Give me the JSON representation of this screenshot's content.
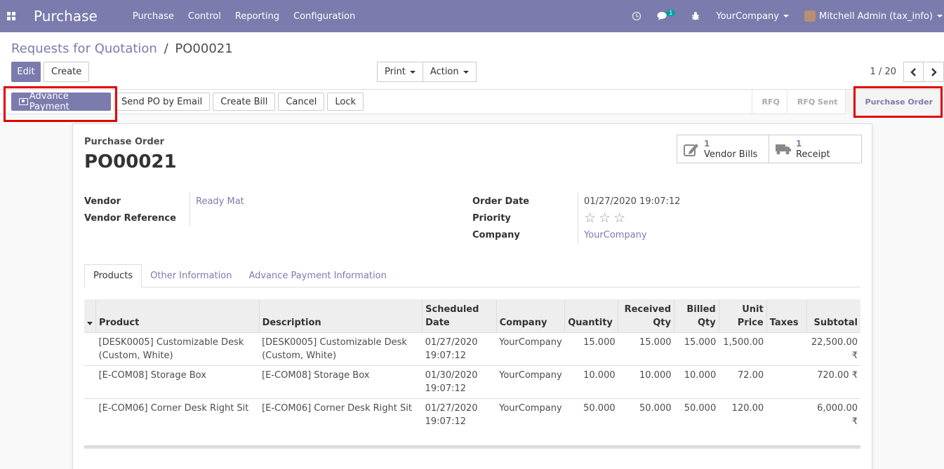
{
  "navbar": {
    "app_name": "Purchase",
    "menu": [
      "Purchase",
      "Control",
      "Reporting",
      "Configuration"
    ],
    "message_count": "1",
    "company": "YourCompany",
    "user": "Mitchell Admin (tax_info)",
    "bg_color": "#7c7bad"
  },
  "breadcrumb": {
    "parent": "Requests for Quotation",
    "separator": "/",
    "current": "PO00021"
  },
  "control": {
    "edit": "Edit",
    "create": "Create",
    "print": "Print",
    "action": "Action",
    "pager": "1 / 20"
  },
  "actions": {
    "advance_payment": "Advance Payment",
    "send_po": "Send PO by Email",
    "create_bill": "Create Bill",
    "cancel": "Cancel",
    "lock": "Lock"
  },
  "stages": [
    "RFQ",
    "RFQ Sent",
    "Purchase Order"
  ],
  "form": {
    "doc_label": "Purchase Order",
    "doc_name": "PO00021",
    "smart_buttons": [
      {
        "count": "1",
        "label": "Vendor Bills",
        "icon": "pencil-square-icon"
      },
      {
        "count": "1",
        "label": "Receipt",
        "icon": "truck-icon"
      }
    ],
    "left_fields": [
      {
        "label": "Vendor",
        "value": "Ready Mat"
      },
      {
        "label": "Vendor Reference",
        "value": ""
      }
    ],
    "right_fields": {
      "order_date_label": "Order Date",
      "order_date": "01/27/2020 19:07:12",
      "priority_label": "Priority",
      "company_label": "Company",
      "company": "YourCompany"
    }
  },
  "tabs": [
    "Products",
    "Other Information",
    "Advance Payment Information"
  ],
  "table": {
    "headers": [
      "Product",
      "Description",
      "Scheduled Date",
      "Company",
      "Quantity",
      "Received Qty",
      "Billed Qty",
      "Unit Price",
      "Taxes",
      "Subtotal"
    ],
    "rows": [
      {
        "product": "[DESK0005] Customizable Desk (Custom, White)",
        "description": "[DESK0005] Customizable Desk (Custom, White)",
        "date": "01/27/2020 19:07:12",
        "company": "YourCompany",
        "qty": "15.000",
        "received": "15.000",
        "billed": "15.000",
        "price": "1,500.00",
        "taxes": "",
        "subtotal": "22,500.00 ₹"
      },
      {
        "product": "[E-COM08] Storage Box",
        "description": "[E-COM08] Storage Box",
        "date": "01/30/2020 19:07:12",
        "company": "YourCompany",
        "qty": "10.000",
        "received": "10.000",
        "billed": "10.000",
        "price": "72.00",
        "taxes": "",
        "subtotal": "720.00 ₹"
      },
      {
        "product": "[E-COM06] Corner Desk Right Sit",
        "description": "[E-COM06] Corner Desk Right Sit",
        "date": "01/27/2020 19:07:12",
        "company": "YourCompany",
        "qty": "50.000",
        "received": "50.000",
        "billed": "50.000",
        "price": "120.00",
        "taxes": "",
        "subtotal": "6,000.00 ₹"
      }
    ]
  }
}
